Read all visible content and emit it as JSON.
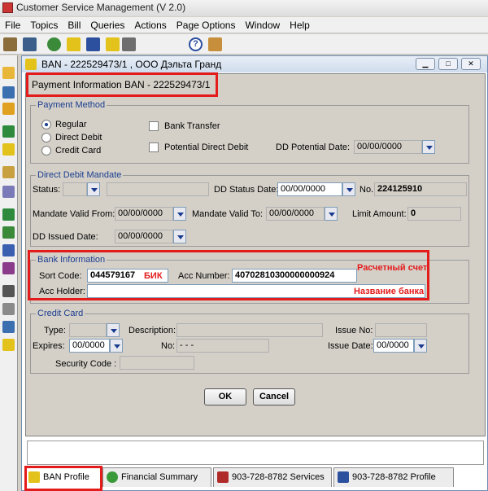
{
  "app": {
    "title": "Customer Service Management  (V 2.0)"
  },
  "menu": [
    "File",
    "Topics",
    "Bill",
    "Queries",
    "Actions",
    "Page Options",
    "Window",
    "Help"
  ],
  "window": {
    "title": "BAN - 222529473/1 , ООО Дэльта Гранд"
  },
  "dialog": {
    "title": "Payment Information   BAN - 222529473/1"
  },
  "payment_method": {
    "legend": "Payment Method",
    "regular": "Regular",
    "direct_debit": "Direct Debit",
    "credit_card": "Credit Card",
    "bank_transfer": "Bank Transfer",
    "potential_direct_debit": "Potential Direct Debit",
    "dd_potential_date_label": "DD Potential Date:",
    "dd_potential_date": "00/00/0000"
  },
  "direct_debit_mandate": {
    "legend": "Direct Debit Mandate",
    "status_label": "Status:",
    "dd_status_date_label": "DD Status Date:",
    "dd_status_date": "00/00/0000",
    "no_label": "No.:",
    "no": "224125910",
    "valid_from_label": "Mandate Valid From:",
    "valid_from": "00/00/0000",
    "valid_to_label": "Mandate Valid To:",
    "valid_to": "00/00/0000",
    "limit_label": "Limit Amount:",
    "limit": "0",
    "issued_label": "DD Issued Date:",
    "issued": "00/00/0000"
  },
  "bank_information": {
    "legend": "Bank Information",
    "sort_code_label": "Sort Code:",
    "sort_code": "044579167",
    "bik_note": "БИК",
    "acc_number_label": "Acc Number:",
    "acc_number": "40702810300000000924",
    "account_note": "Расчетный счет",
    "acc_holder_label": "Acc Holder:",
    "bank_name_note": "Название банка"
  },
  "credit_card": {
    "legend": "Credit Card",
    "type_label": "Type:",
    "description_label": "Description:",
    "issue_no_label": "Issue No:",
    "expires_label": "Expires:",
    "expires": "00/0000",
    "no_label": "No:",
    "no": "-   -   -",
    "issue_date_label": "Issue Date:",
    "issue_date": "00/0000",
    "security_code_label": "Security Code :"
  },
  "buttons": {
    "ok": "OK",
    "cancel": "Cancel"
  },
  "tabs": [
    "BAN Profile",
    "Financial Summary",
    "903-728-8782 Services",
    "903-728-8782 Profile"
  ]
}
